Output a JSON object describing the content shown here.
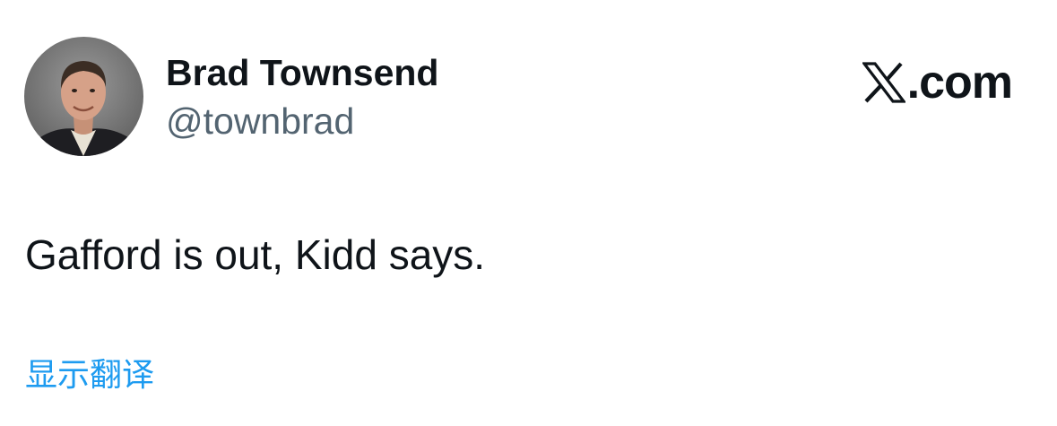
{
  "author": {
    "name": "Brad Townsend",
    "handle": "@townbrad",
    "avatar_icon": "profile-photo"
  },
  "brand": {
    "icon": "x-logo-icon",
    "domain": ".com"
  },
  "tweet": {
    "text": "Gafford is out, Kidd says."
  },
  "actions": {
    "translate_label": "显示翻译"
  },
  "colors": {
    "text": "#0f1419",
    "secondary_text": "#536471",
    "link": "#1d9bf0",
    "background": "#ffffff"
  }
}
